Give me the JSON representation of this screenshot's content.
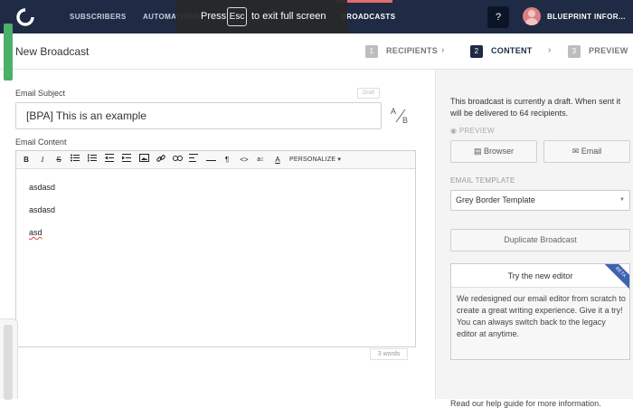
{
  "nav": {
    "items": [
      "SUBSCRIBERS",
      "AUTOMATIONS",
      "BROADCASTS"
    ],
    "help": "?",
    "account": "BLUEPRINT INFOR..."
  },
  "fullscreen_toast": {
    "press": "Press",
    "key": "Esc",
    "text": "to exit full screen"
  },
  "page": {
    "title": "New Broadcast"
  },
  "steps": [
    {
      "num": "1",
      "label": "RECIPIENTS"
    },
    {
      "num": "2",
      "label": "CONTENT"
    },
    {
      "num": "3",
      "label": "PREVIEW"
    }
  ],
  "form": {
    "subject_label": "Email Subject",
    "draft_badge": "Draft",
    "subject_value": "[BPA] This is an example",
    "ab_top": "A",
    "ab_bottom": "B",
    "content_label": "Email Content",
    "personalize": "PERSONALIZE",
    "content_lines": [
      "asdasd",
      "asdasd",
      "asd"
    ],
    "word_count": "3 words"
  },
  "toolbar_icons": [
    "bold-icon",
    "italic-icon",
    "strikethrough-icon",
    "bullet-list-icon",
    "numbered-list-icon",
    "outdent-icon",
    "indent-icon",
    "image-icon",
    "link-icon",
    "unlink-icon",
    "align-icon",
    "horizontal-rule-icon",
    "paragraph-icon",
    "code-icon",
    "line-height-icon",
    "text-color-icon"
  ],
  "sidebar": {
    "draft_info": "This broadcast is currently a draft. When sent it will be delivered to 64 recipients.",
    "preview_label": "PREVIEW",
    "browser_btn": "Browser",
    "email_btn": "Email",
    "template_label": "EMAIL TEMPLATE",
    "template_value": "Grey Border Template",
    "duplicate_btn": "Duplicate Broadcast",
    "editor_card_title": "Try the new editor",
    "beta": "BETA",
    "editor_card_body": "We redesigned our email editor from scratch to create a great writing experience. Give it a try! You can always switch back to the legacy editor at anytime.",
    "help_text": "Read our help guide for more information."
  },
  "colors": {
    "nav_bg": "#1f2a44",
    "accent_red": "#e26b6b",
    "beta_blue": "#3d63b0",
    "progress_green": "#4caf6a"
  }
}
